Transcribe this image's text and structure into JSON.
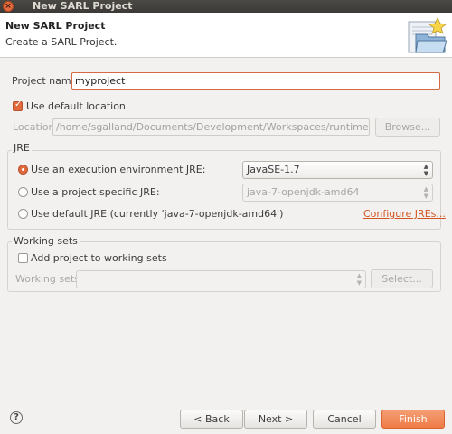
{
  "window": {
    "title": "New SARL Project",
    "close_glyph": "×"
  },
  "header": {
    "title": "New SARL Project",
    "description": "Create a SARL Project."
  },
  "project_name": {
    "label": "Project name:",
    "value": "myproject"
  },
  "use_default_location": {
    "label": "Use default location",
    "checked": true
  },
  "location": {
    "label": "Location:",
    "value": "/home/sgalland/Documents/Development/Workspaces/runtime-debug-sarl",
    "browse_label": "Browse..."
  },
  "jre": {
    "group_label": "JRE",
    "exec_env": {
      "label": "Use an execution environment JRE:",
      "selected": true,
      "combo_value": "JavaSE-1.7"
    },
    "project_specific": {
      "label": "Use a project specific JRE:",
      "selected": false,
      "combo_value": "java-7-openjdk-amd64"
    },
    "default_jre": {
      "label": "Use default JRE (currently 'java-7-openjdk-amd64')",
      "selected": false
    },
    "configure_link": "Configure JREs..."
  },
  "working_sets": {
    "group_label": "Working sets",
    "add_label": "Add project to working sets",
    "add_checked": false,
    "sets_label": "Working sets:",
    "sets_value": "",
    "select_label": "Select..."
  },
  "footer": {
    "help_glyph": "?",
    "back_label": "< Back",
    "next_label": "Next >",
    "cancel_label": "Cancel",
    "finish_label": "Finish"
  },
  "colors": {
    "accent": "#e0693d",
    "link": "#d2541f",
    "titlebar": "#3c3b37"
  }
}
